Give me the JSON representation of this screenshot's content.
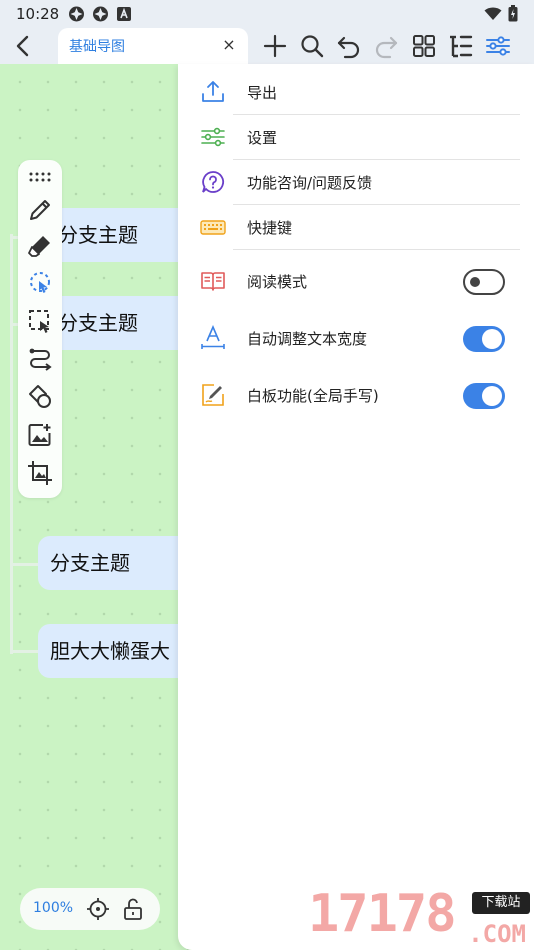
{
  "status_bar": {
    "time": "10:28"
  },
  "toolbar": {
    "tab_title": "基础导图",
    "close_glyph": "×"
  },
  "canvas": {
    "nodes": [
      "分支主题",
      "分支主题",
      "分支主题",
      "胆大大懒蛋大"
    ]
  },
  "zoom": {
    "level": "100%"
  },
  "menu": {
    "items": [
      {
        "label": "导出",
        "icon": "upload-icon"
      },
      {
        "label": "设置",
        "icon": "settings-sliders-icon"
      },
      {
        "label": "功能咨询/问题反馈",
        "icon": "help-circle-icon"
      },
      {
        "label": "快捷键",
        "icon": "keyboard-icon"
      },
      {
        "label": "阅读模式",
        "icon": "book-icon",
        "toggle": false
      },
      {
        "label": "自动调整文本宽度",
        "icon": "text-width-icon",
        "toggle": true
      },
      {
        "label": "白板功能(全局手写)",
        "icon": "whiteboard-pen-icon",
        "toggle": true
      }
    ]
  },
  "watermark": {
    "number": "17178",
    "badge": "下载站",
    "suffix": ".COM"
  },
  "colors": {
    "accent": "#3b82e6",
    "canvas": "#cbf3c4",
    "node": "#dcebfd"
  }
}
